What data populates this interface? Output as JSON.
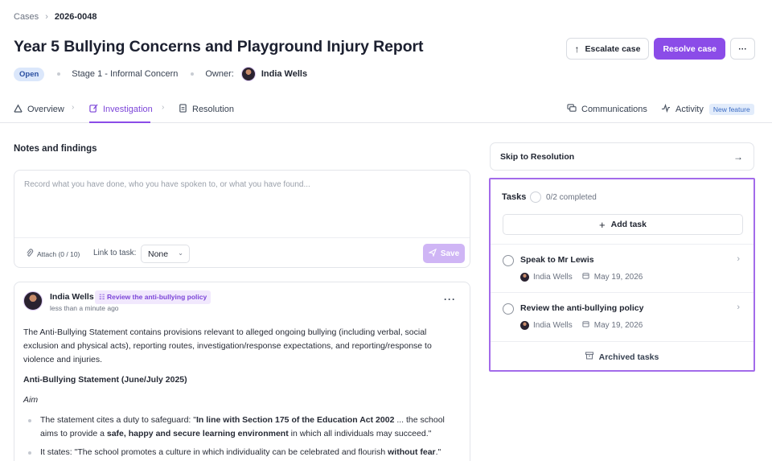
{
  "breadcrumb": {
    "parent": "Cases",
    "current": "2026-0048"
  },
  "case": {
    "title": "Year 5 Bullying Concerns and Playground Injury Report",
    "status": "Open",
    "stage": "Stage 1 - Informal Concern",
    "owner_label": "Owner:",
    "owner_name": "India Wells"
  },
  "actions": {
    "escalate": "Escalate case",
    "resolve": "Resolve case"
  },
  "tabs": {
    "overview": "Overview",
    "investigation": "Investigation",
    "resolution": "Resolution",
    "communications": "Communications",
    "activity": "Activity",
    "new_feature": "New feature"
  },
  "notes": {
    "title": "Notes and findings",
    "placeholder": "Record what you have done, who you have spoken to, or what you have found...",
    "attach": "Attach (0 / 10)",
    "link_label": "Link to task:",
    "link_value": "None",
    "save": "Save"
  },
  "comment": {
    "author": "India Wells",
    "task_chip": "Review the anti-bullying policy",
    "time": "less than a minute ago",
    "intro": "The Anti-Bullying Statement contains provisions relevant to alleged ongoing bullying (including verbal, social exclusion and physical acts), reporting routes, investigation/response expectations, and reporting/response to violence and injuries.",
    "heading": "Anti-Bullying Statement (June/July 2025)",
    "aim": "Aim",
    "b1_pre": "The statement cites a duty to safeguard: \"",
    "b1_bold": "In line with Section 175 of the Education Act 2002",
    "b1_mid": " ... the school aims to provide a ",
    "b1_bold2": "safe, happy and secure learning environment",
    "b1_post": " in which all individuals may succeed.\"",
    "b2_pre": "It states: \"The school promotes a culture in which individuality can be celebrated and flourish ",
    "b2_bold": "without fear",
    "b2_post": ".\""
  },
  "skip": {
    "label": "Skip to Resolution"
  },
  "tasks": {
    "title": "Tasks",
    "progress": "0/2 completed",
    "add": "Add task",
    "items": [
      {
        "name": "Speak to Mr Lewis",
        "assignee": "India Wells",
        "date": "May 19, 2026"
      },
      {
        "name": "Review the anti-bullying policy",
        "assignee": "India Wells",
        "date": "May 19, 2026"
      }
    ],
    "archived": "Archived tasks"
  },
  "colors": {
    "accent": "#8b4ce8",
    "accent_light": "#cfb5f5",
    "open_badge_bg": "#dbe7fb"
  },
  "icons": [
    "chevron-right-icon",
    "arrow-up-icon",
    "more-icon",
    "overview-icon",
    "edit-icon",
    "clipboard-icon",
    "chat-icon",
    "activity-icon",
    "paperclip-icon",
    "send-icon",
    "arrow-right-icon",
    "plus-icon",
    "calendar-icon",
    "archive-icon"
  ]
}
